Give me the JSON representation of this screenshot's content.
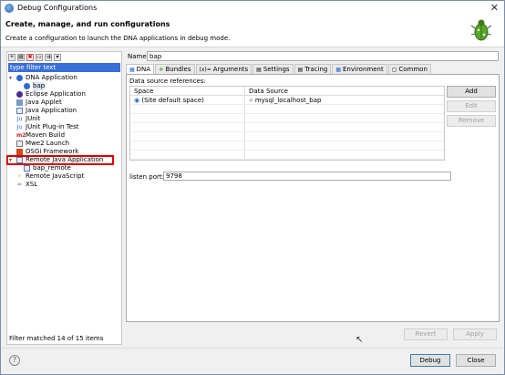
{
  "window": {
    "title": "Debug Configurations",
    "close_glyph": "✕"
  },
  "header": {
    "title": "Create, manage, and run configurations",
    "description": "Create a configuration to launch the DNA applications in debug mode."
  },
  "left": {
    "filter_placeholder": "type filter text",
    "tree": [
      {
        "label": "DNA Application",
        "icon": "gear-icon",
        "level": 0,
        "expanded": true
      },
      {
        "label": "bap",
        "icon": "dna-config-icon",
        "level": 1,
        "selected": true
      },
      {
        "label": "Eclipse Application",
        "icon": "eclipse-icon",
        "level": 0
      },
      {
        "label": "Java Applet",
        "icon": "applet-icon",
        "level": 0
      },
      {
        "label": "Java Application",
        "icon": "java-app-icon",
        "level": 0
      },
      {
        "label": "JUnit",
        "icon": "junit-icon",
        "level": 0
      },
      {
        "label": "JUnit Plug-in Test",
        "icon": "junit-plugin-icon",
        "level": 0
      },
      {
        "label": "Maven Build",
        "icon": "maven-icon",
        "level": 0
      },
      {
        "label": "Mwe2 Launch",
        "icon": "mwe2-icon",
        "level": 0
      },
      {
        "label": "OSGi Framework",
        "icon": "osgi-icon",
        "level": 0
      },
      {
        "label": "Remote Java Application",
        "icon": "remote-java-icon",
        "level": 0,
        "expanded": true,
        "highlighted": true
      },
      {
        "label": "bap_remote",
        "icon": "remote-config-icon",
        "level": 1
      },
      {
        "label": "Remote JavaScript",
        "icon": "remote-js-icon",
        "level": 0
      },
      {
        "label": "XSL",
        "icon": "xsl-icon",
        "level": 0
      }
    ],
    "footer_text": "Filter matched 14 of 15 items"
  },
  "right": {
    "name_label": "Name:",
    "name_value": "bap",
    "tabs": [
      {
        "label": "DNA",
        "active": true
      },
      {
        "label": "Bundles"
      },
      {
        "label": "Arguments"
      },
      {
        "label": "Settings"
      },
      {
        "label": "Tracing"
      },
      {
        "label": "Environment"
      },
      {
        "label": "Common"
      }
    ],
    "data_source_title": "Data source references:",
    "table": {
      "columns": [
        "Space",
        "Data Source"
      ],
      "rows": [
        [
          "(Site default space)",
          "mysql_localhost_bap"
        ]
      ]
    },
    "buttons": {
      "add": "Add",
      "edit": "Edit",
      "remove": "Remove"
    },
    "listen_port_label": "listen port:",
    "listen_port_value": "9798",
    "revert": "Revert",
    "apply": "Apply"
  },
  "footer": {
    "help": "?",
    "debug": "Debug",
    "close": "Close"
  }
}
